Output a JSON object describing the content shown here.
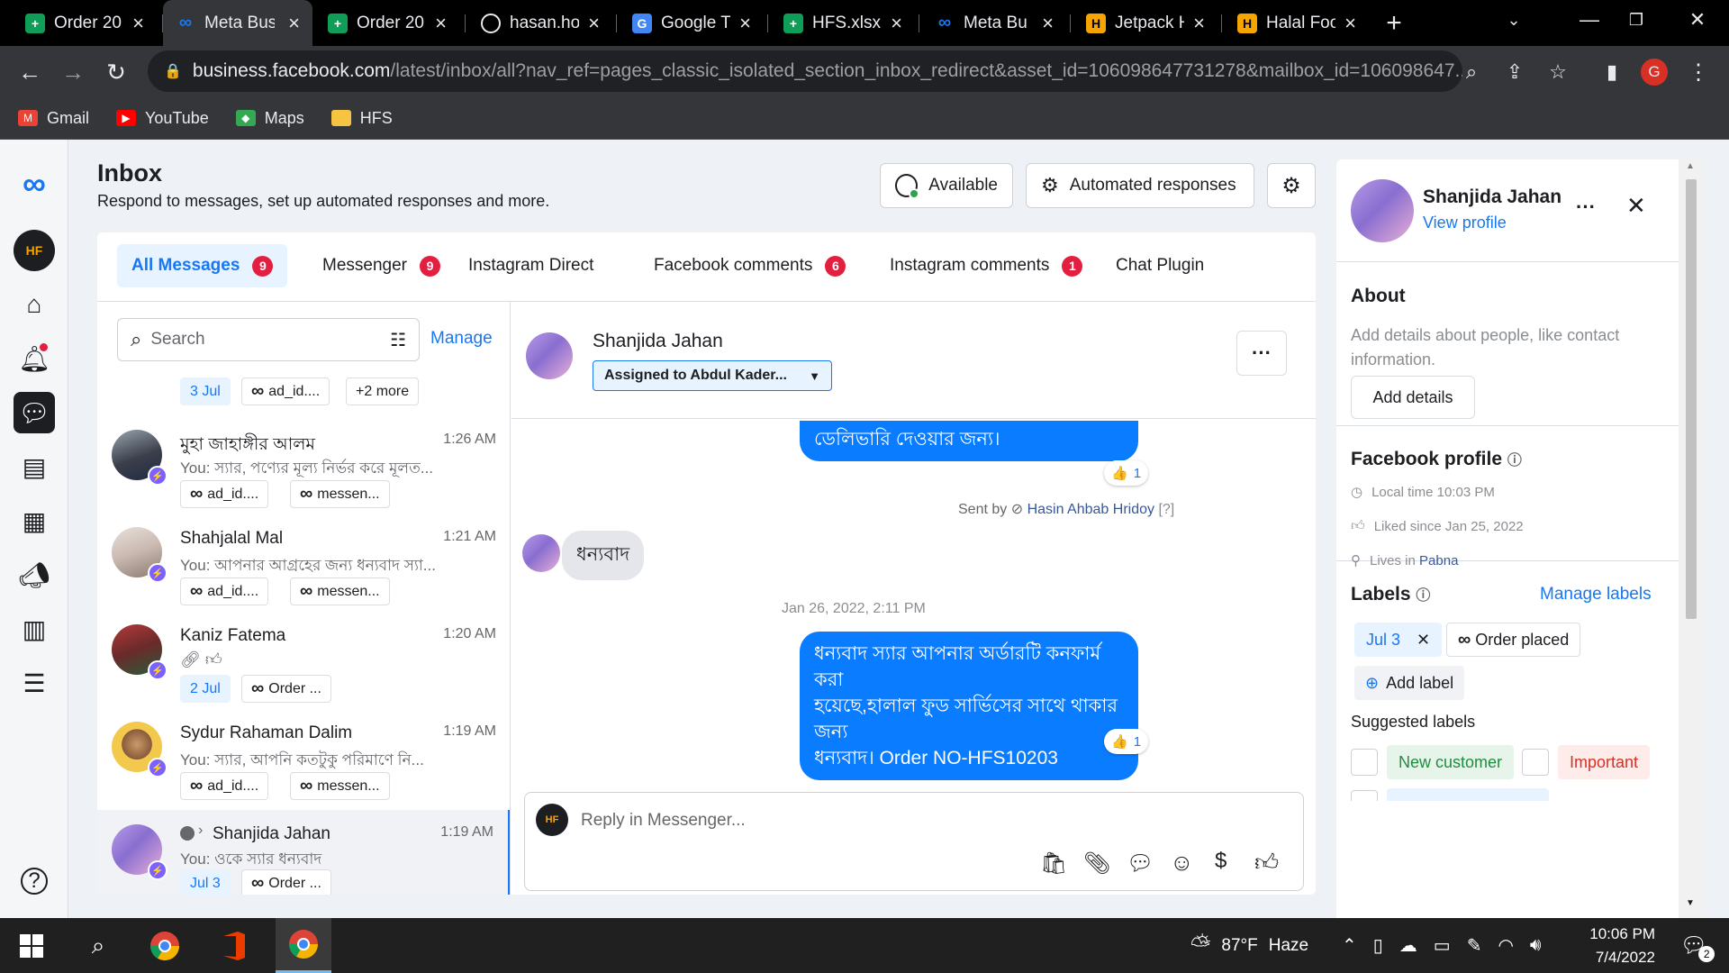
{
  "browser": {
    "tabs": [
      {
        "title": "Order 20",
        "icon": "sheets-icon"
      },
      {
        "title": "Meta Bus",
        "icon": "meta-icon",
        "active": true
      },
      {
        "title": "Order 20",
        "icon": "sheets-icon"
      },
      {
        "title": "hasan.ho",
        "icon": "globe-icon"
      },
      {
        "title": "Google T",
        "icon": "translate-icon"
      },
      {
        "title": "HFS.xlsx",
        "icon": "sheets-icon"
      },
      {
        "title": "Meta Bu",
        "icon": "meta-icon"
      },
      {
        "title": "Jetpack H",
        "icon": "halal-food-icon"
      },
      {
        "title": "Halal Foo",
        "icon": "halal-food-icon"
      }
    ],
    "url_domain": "business.facebook.com",
    "url_path": "/latest/inbox/all?nav_ref=pages_classic_isolated_section_inbox_redirect&asset_id=106098647731278&mailbox_id=106098647...",
    "profile_initial": "G",
    "bookmarks": [
      {
        "label": "Gmail",
        "icon": "gmail-icon",
        "color": "#ea4335"
      },
      {
        "label": "YouTube",
        "icon": "youtube-icon",
        "color": "#ff0000"
      },
      {
        "label": "Maps",
        "icon": "maps-icon",
        "color": "#34a853"
      },
      {
        "label": "HFS",
        "icon": "folder-icon",
        "color": "#f6c343"
      }
    ]
  },
  "header": {
    "title": "Inbox",
    "subtitle": "Respond to messages, set up automated responses and more.",
    "available_label": "Available",
    "automated_label": "Automated responses"
  },
  "filters": [
    {
      "label": "All Messages",
      "count": "9",
      "active": true
    },
    {
      "label": "Messenger",
      "count": "9"
    },
    {
      "label": "Instagram Direct",
      "count": ""
    },
    {
      "label": "Facebook comments",
      "count": "6"
    },
    {
      "label": "Instagram comments",
      "count": "1"
    },
    {
      "label": "Chat Plugin",
      "count": ""
    }
  ],
  "search": {
    "placeholder": "Search",
    "manage_label": "Manage"
  },
  "partial_row": {
    "date_chip": "3 Jul",
    "label_chip": "ad_id....",
    "more_chip": "+2 more"
  },
  "conversations": [
    {
      "name": "মুহা জাহাঙ্গীর আলম",
      "preview": "You: স্যার, পণ্যের মূল্য নির্ভর করে মূলত...",
      "time": "1:26 AM",
      "chips": [
        "ad_id....",
        "messen..."
      ]
    },
    {
      "name": "Shahjalal Mal",
      "preview": "You: আপনার আগ্রহের জন্য ধন্যবাদ স্যা...",
      "time": "1:21 AM",
      "chips": [
        "ad_id....",
        "messen..."
      ]
    },
    {
      "name": "Kaniz Fatema",
      "preview": "",
      "time": "1:20 AM",
      "date_chip": "2 Jul",
      "chips": [
        "Order ..."
      ]
    },
    {
      "name": "Sydur Rahaman Dalim",
      "preview": "You: স্যার, আপনি কতটুকু পরিমাণে নি...",
      "time": "1:19 AM",
      "chips": [
        "ad_id....",
        "messen..."
      ]
    },
    {
      "name": "Shanjida Jahan",
      "preview": "You: ওকে স্যার ধন্যবাদ",
      "time": "1:19 AM",
      "date_chip": "Jul 3",
      "chips": [
        "Order ..."
      ],
      "selected": true
    }
  ],
  "chat": {
    "contact_name": "Shanjida Jahan",
    "assigned": "Assigned to Abdul Kader...",
    "msg1": "ডেলিভারি দেওয়ার জন্য।",
    "msg1_reaction": "1",
    "sent_by_prefix": "Sent by",
    "sent_by_name": "Hasin Ahbab Hridoy",
    "sent_by_help": "[?]",
    "msg2": "ধন্যবাদ",
    "timestamp": "Jan 26, 2022, 2:11 PM",
    "msg3_line1": "ধন্যবাদ স্যার আপনার অর্ডারটি কনফার্ম করা",
    "msg3_line2": "হয়েছে,হালাল ফুড সার্ভিসের সাথে থাকার জন্য",
    "msg3_line3": "ধন্যবাদ। Order NO-HFS10203",
    "msg3_reaction": "1",
    "reply_placeholder": "Reply in Messenger..."
  },
  "profile": {
    "name": "Shanjida Jahan",
    "view_profile": "View profile",
    "about_title": "About",
    "about_text": "Add details about people, like contact information.",
    "add_details": "Add details",
    "fb_title": "Facebook profile",
    "local_time": "Local time 10:03 PM",
    "liked_since": "Liked since Jan 25, 2022",
    "lives_prefix": "Lives in",
    "lives_city": "Pabna",
    "labels_title": "Labels",
    "manage_labels": "Manage labels",
    "label_date": "Jul 3",
    "label_order": "Order placed",
    "add_label": "Add label",
    "suggested_title": "Suggested labels",
    "suggested": [
      "New customer",
      "Important"
    ]
  },
  "taskbar": {
    "temp": "87°F",
    "weather": "Haze",
    "time": "10:06 PM",
    "date": "7/4/2022",
    "notifications": "2"
  },
  "colors": {
    "accent": "#1877f2",
    "bubble": "#0a7cff",
    "badge": "#e41e3f"
  }
}
